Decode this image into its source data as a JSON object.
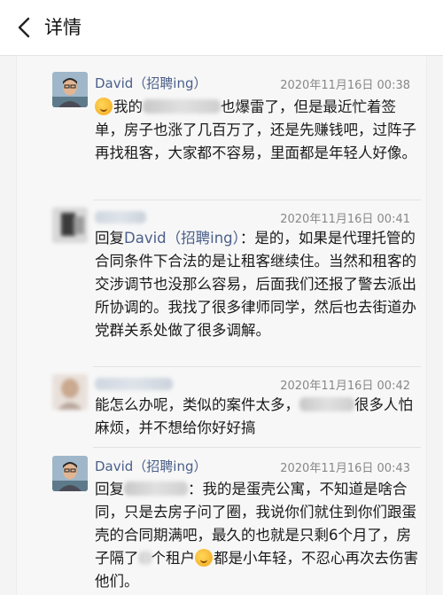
{
  "header": {
    "title": "详情",
    "back_icon": "chevron-left-icon"
  },
  "comments": [
    {
      "author": "David（招聘ing）",
      "time": "2020年11月16日 00:38",
      "text_a": "我的",
      "text_b": "也爆雷了，但是最近忙着签单，房子也涨了几百万了，还是先赚钱吧，过阵子再找租客，大家都不容易，里面都是年轻人好像。"
    },
    {
      "author": "",
      "time": "2020年11月16日 00:41",
      "reply_prefix": "回复",
      "reply_to": "David（招聘ing）",
      "text": "：是的，如果是代理托管的合同条件下合法的是让租客继续住。当然和租客的交涉调节也没那么容易，后面我们还报了警去派出所协调的。我找了很多律师同学，然后也去街道办党群关系处做了很多调解。"
    },
    {
      "author": "",
      "time": "2020年11月16日 00:42",
      "text_a": "能怎么办呢，类似的案件太多，",
      "text_b": "很多人怕麻烦，并不想给你好好搞"
    },
    {
      "author": "David（招聘ing）",
      "time": "2020年11月16日 00:43",
      "reply_prefix": "回复",
      "text_a": "：我的是蛋壳公寓，不知道是啥合同，只是去房子问了圈，我说你们就住到你们跟蛋壳的合同期满吧，最久的也就是只剩6个月了，房子隔了",
      "text_b": "个租户",
      "text_c": "都是小年轻，不忍心再次去伤害他们。"
    }
  ]
}
